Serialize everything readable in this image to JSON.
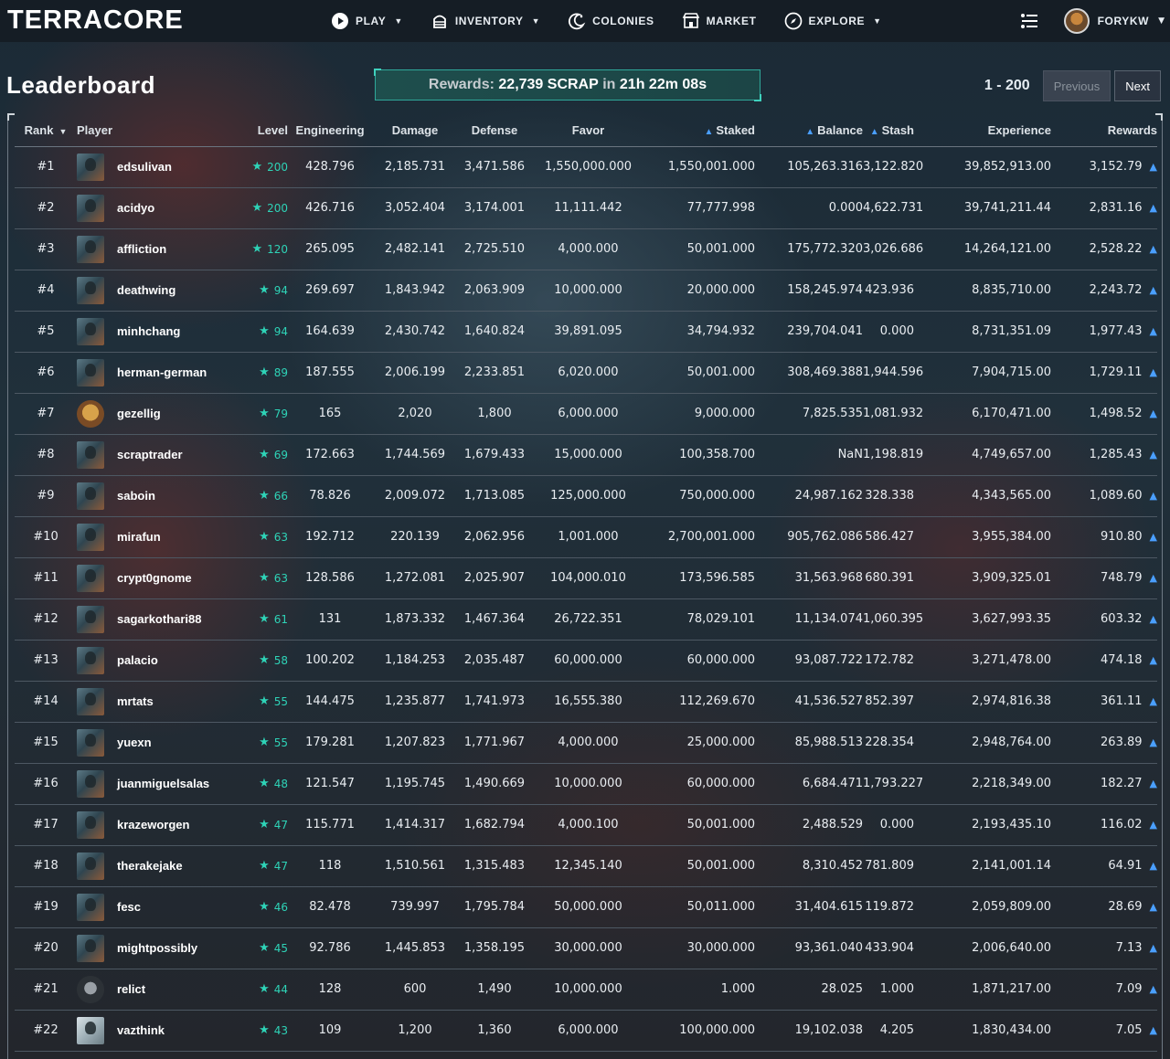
{
  "app": {
    "logo": "TERRACORE",
    "nav": [
      {
        "label": "PLAY",
        "icon": "play-icon",
        "dropdown": true
      },
      {
        "label": "INVENTORY",
        "icon": "inventory-icon",
        "dropdown": true
      },
      {
        "label": "COLONIES",
        "icon": "colonies-icon",
        "dropdown": false
      },
      {
        "label": "MARKET",
        "icon": "market-icon",
        "dropdown": false
      },
      {
        "label": "EXPLORE",
        "icon": "compass-icon",
        "dropdown": true
      }
    ],
    "user": {
      "name": "FORYKW"
    }
  },
  "page": {
    "title": "Leaderboard",
    "rewards": {
      "prefix": "Rewards:",
      "amount": "22,739 SCRAP",
      "middle": "in",
      "time": "21h 22m 08s"
    },
    "pager": {
      "range": "1 - 200",
      "previous": "Previous",
      "next": "Next"
    }
  },
  "colors": {
    "accent": "#2ed3b7",
    "hive": "#4a9fff",
    "banner_border": "#2fa89a"
  },
  "table": {
    "headers": {
      "rank": "Rank",
      "player": "Player",
      "level": "Level",
      "engineering": "Engineering",
      "damage": "Damage",
      "defense": "Defense",
      "favor": "Favor",
      "staked": "Staked",
      "balance": "Balance",
      "stash": "Stash",
      "experience": "Experience",
      "rewards": "Rewards"
    },
    "rows": [
      [
        "#1",
        "edsulivan",
        "200",
        "428.796",
        "2,185.731",
        "3,471.586",
        "1,550,000.000",
        "1,550,001.000",
        "105,263.316",
        "3,122.820",
        "39,852,913.00",
        "3,152.79"
      ],
      [
        "#2",
        "acidyo",
        "200",
        "426.716",
        "3,052.404",
        "3,174.001",
        "11,111.442",
        "77,777.998",
        "0.000",
        "4,622.731",
        "39,741,211.44",
        "2,831.16"
      ],
      [
        "#3",
        "affliction",
        "120",
        "265.095",
        "2,482.141",
        "2,725.510",
        "4,000.000",
        "50,001.000",
        "175,772.320",
        "3,026.686",
        "14,264,121.00",
        "2,528.22"
      ],
      [
        "#4",
        "deathwing",
        "94",
        "269.697",
        "1,843.942",
        "2,063.909",
        "10,000.000",
        "20,000.000",
        "158,245.974",
        "423.936",
        "8,835,710.00",
        "2,243.72"
      ],
      [
        "#5",
        "minhchang",
        "94",
        "164.639",
        "2,430.742",
        "1,640.824",
        "39,891.095",
        "34,794.932",
        "239,704.041",
        "0.000",
        "8,731,351.09",
        "1,977.43"
      ],
      [
        "#6",
        "herman-german",
        "89",
        "187.555",
        "2,006.199",
        "2,233.851",
        "6,020.000",
        "50,001.000",
        "308,469.388",
        "1,944.596",
        "7,904,715.00",
        "1,729.11"
      ],
      [
        "#7",
        "gezellig",
        "79",
        "165",
        "2,020",
        "1,800",
        "6,000.000",
        "9,000.000",
        "7,825.535",
        "1,081.932",
        "6,170,471.00",
        "1,498.52"
      ],
      [
        "#8",
        "scraptrader",
        "69",
        "172.663",
        "1,744.569",
        "1,679.433",
        "15,000.000",
        "100,358.700",
        "NaN",
        "1,198.819",
        "4,749,657.00",
        "1,285.43"
      ],
      [
        "#9",
        "saboin",
        "66",
        "78.826",
        "2,009.072",
        "1,713.085",
        "125,000.000",
        "750,000.000",
        "24,987.162",
        "328.338",
        "4,343,565.00",
        "1,089.60"
      ],
      [
        "#10",
        "mirafun",
        "63",
        "192.712",
        "220.139",
        "2,062.956",
        "1,001.000",
        "2,700,001.000",
        "905,762.086",
        "586.427",
        "3,955,384.00",
        "910.80"
      ],
      [
        "#11",
        "crypt0gnome",
        "63",
        "128.586",
        "1,272.081",
        "2,025.907",
        "104,000.010",
        "173,596.585",
        "31,563.968",
        "680.391",
        "3,909,325.01",
        "748.79"
      ],
      [
        "#12",
        "sagarkothari88",
        "61",
        "131",
        "1,873.332",
        "1,467.364",
        "26,722.351",
        "78,029.101",
        "11,134.074",
        "1,060.395",
        "3,627,993.35",
        "603.32"
      ],
      [
        "#13",
        "palacio",
        "58",
        "100.202",
        "1,184.253",
        "2,035.487",
        "60,000.000",
        "60,000.000",
        "93,087.722",
        "172.782",
        "3,271,478.00",
        "474.18"
      ],
      [
        "#14",
        "mrtats",
        "55",
        "144.475",
        "1,235.877",
        "1,741.973",
        "16,555.380",
        "112,269.670",
        "41,536.527",
        "852.397",
        "2,974,816.38",
        "361.11"
      ],
      [
        "#15",
        "yuexn",
        "55",
        "179.281",
        "1,207.823",
        "1,771.967",
        "4,000.000",
        "25,000.000",
        "85,988.513",
        "228.354",
        "2,948,764.00",
        "263.89"
      ],
      [
        "#16",
        "juanmiguelsalas",
        "48",
        "121.547",
        "1,195.745",
        "1,490.669",
        "10,000.000",
        "60,000.000",
        "6,684.471",
        "1,793.227",
        "2,218,349.00",
        "182.27"
      ],
      [
        "#17",
        "krazeworgen",
        "47",
        "115.771",
        "1,414.317",
        "1,682.794",
        "4,000.100",
        "50,001.000",
        "2,488.529",
        "0.000",
        "2,193,435.10",
        "116.02"
      ],
      [
        "#18",
        "therakejake",
        "47",
        "118",
        "1,510.561",
        "1,315.483",
        "12,345.140",
        "50,001.000",
        "8,310.452",
        "781.809",
        "2,141,001.14",
        "64.91"
      ],
      [
        "#19",
        "fesc",
        "46",
        "82.478",
        "739.997",
        "1,795.784",
        "50,000.000",
        "50,011.000",
        "31,404.615",
        "119.872",
        "2,059,809.00",
        "28.69"
      ],
      [
        "#20",
        "mightpossibly",
        "45",
        "92.786",
        "1,445.853",
        "1,358.195",
        "30,000.000",
        "30,000.000",
        "93,361.040",
        "433.904",
        "2,006,640.00",
        "7.13"
      ],
      [
        "#21",
        "relict",
        "44",
        "128",
        "600",
        "1,490",
        "10,000.000",
        "1.000",
        "28.025",
        "1.000",
        "1,871,217.00",
        "7.09"
      ],
      [
        "#22",
        "vazthink",
        "43",
        "109",
        "1,200",
        "1,360",
        "6,000.000",
        "100,000.000",
        "19,102.038",
        "4.205",
        "1,830,434.00",
        "7.05"
      ]
    ]
  }
}
